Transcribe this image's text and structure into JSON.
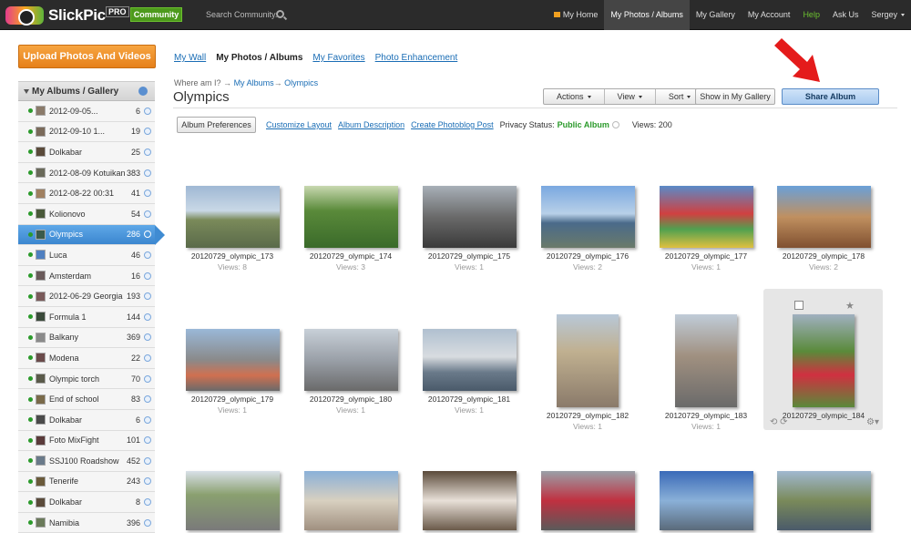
{
  "header": {
    "logo_text": "SlickPic",
    "logo_badge": "PRO",
    "community_label": "Community",
    "search_placeholder": "Search Community...",
    "nav": [
      {
        "label": "My Home"
      },
      {
        "label": "My Photos / Albums",
        "active": true
      },
      {
        "label": "My Gallery"
      },
      {
        "label": "My Account"
      },
      {
        "label": "Help"
      },
      {
        "label": "Ask Us"
      },
      {
        "label": "Sergey"
      }
    ]
  },
  "sidebar": {
    "upload_label": "Upload Photos And Videos",
    "header_label": "My Albums / Gallery",
    "albums": [
      {
        "label": "2012-09-05...",
        "count": "6"
      },
      {
        "label": "2012-09-10 1...",
        "count": "19"
      },
      {
        "label": "Dolkabar",
        "count": "25"
      },
      {
        "label": "2012-08-09 Kotuikan",
        "count": "383"
      },
      {
        "label": "2012-08-22 00:31",
        "count": "41"
      },
      {
        "label": "Kolionovo",
        "count": "54"
      },
      {
        "label": "Olympics",
        "count": "286",
        "active": true
      },
      {
        "label": "Luca",
        "count": "46"
      },
      {
        "label": "Amsterdam",
        "count": "16"
      },
      {
        "label": "2012-06-29 Georgia",
        "count": "193"
      },
      {
        "label": "Formula 1",
        "count": "144"
      },
      {
        "label": "Balkany",
        "count": "369"
      },
      {
        "label": "Modena",
        "count": "22"
      },
      {
        "label": "Olympic torch",
        "count": "70"
      },
      {
        "label": "End of school",
        "count": "83"
      },
      {
        "label": "Dolkabar",
        "count": "6"
      },
      {
        "label": "Foto MixFight",
        "count": "101"
      },
      {
        "label": "SSJ100 Roadshow",
        "count": "452"
      },
      {
        "label": "Tenerife",
        "count": "243"
      },
      {
        "label": "Dolkabar",
        "count": "8"
      },
      {
        "label": "Namibia",
        "count": "396"
      }
    ]
  },
  "main": {
    "tabs": [
      "My Wall",
      "My Photos",
      "Albums",
      "My Favorites",
      "Photo Enhancement"
    ],
    "breadcrumb": {
      "prefix": "Where am I?",
      "sep": "→",
      "albums": "My Albums",
      "current": "Olympics"
    },
    "title": "Olympics",
    "toolbar": {
      "actions": "Actions",
      "view": "View",
      "sort": "Sort",
      "show_in_gallery": "Show in My Gallery",
      "share": "Share Album"
    },
    "subbar": {
      "prefs": "Album Preferences",
      "customize": "Customize Layout",
      "description": "Album Description",
      "photoblog": "Create Photoblog Post",
      "privacy_label": "Privacy Status:",
      "privacy_value": "Public Album",
      "views": "Views: 200"
    },
    "photos": [
      {
        "name": "20120729_olympic_173",
        "views": "Views: 8"
      },
      {
        "name": "20120729_olympic_174",
        "views": "Views: 3"
      },
      {
        "name": "20120729_olympic_175",
        "views": "Views: 1"
      },
      {
        "name": "20120729_olympic_176",
        "views": "Views: 2"
      },
      {
        "name": "20120729_olympic_177",
        "views": "Views: 1"
      },
      {
        "name": "20120729_olympic_178",
        "views": "Views: 2"
      },
      {
        "name": "20120729_olympic_179",
        "views": "Views: 1"
      },
      {
        "name": "20120729_olympic_180",
        "views": "Views: 1"
      },
      {
        "name": "20120729_olympic_181",
        "views": "Views: 1"
      },
      {
        "name": "20120729_olympic_182",
        "views": "Views: 1"
      },
      {
        "name": "20120729_olympic_183",
        "views": "Views: 1"
      },
      {
        "name": "20120729_olympic_184",
        "views": ""
      }
    ],
    "colors": {
      "accent": "#3b86cf",
      "orange": "#e6801a",
      "green": "#2b9a2b",
      "arrow": "#e41b1b"
    }
  }
}
